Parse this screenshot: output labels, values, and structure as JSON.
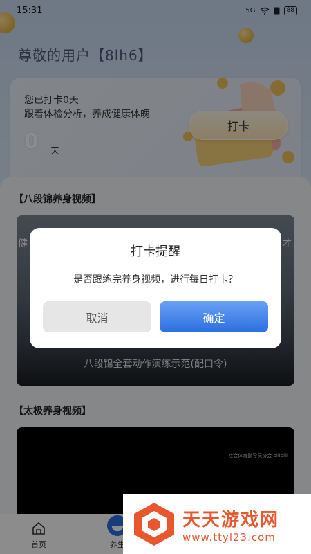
{
  "status_bar": {
    "time": "15:31",
    "signal_text": "5G",
    "battery": "88"
  },
  "header": {
    "greeting": "尊敬的用户【8lh6】"
  },
  "checkin_card": {
    "line1": "您已打卡0天",
    "line2": "跟着体检分析，养成健康体魄",
    "days_count": "0",
    "days_unit": "天",
    "button_label": "打卡"
  },
  "sections": [
    {
      "title": "【八段锦养身视频】",
      "video": {
        "caption": "八段锦全套动作演练示范(配口令)",
        "side_left": "健",
        "side_right": "才"
      }
    },
    {
      "title": "【太极养身视频】",
      "video": {
        "watermark": "社会体育指导员协会 bilibili"
      }
    }
  ],
  "bottom_nav": [
    {
      "label": "首页",
      "icon": "home-icon"
    },
    {
      "label": "养生",
      "icon": "bowl-icon"
    }
  ],
  "dialog": {
    "title": "打卡提醒",
    "message": "是否跟练完养身视频，进行每日打卡？",
    "cancel_label": "取消",
    "confirm_label": "确定"
  },
  "watermark_banner": {
    "title": "天天游戏网",
    "url": "www.ttyl23.com"
  },
  "colors": {
    "accent_blue": "#2b6fe0",
    "watermark_orange": "#e8572d"
  }
}
